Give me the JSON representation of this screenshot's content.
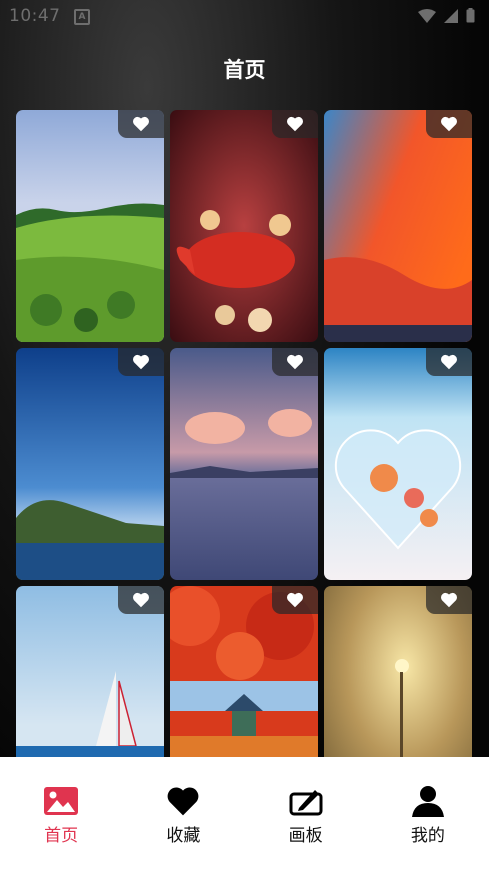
{
  "status_bar": {
    "time": "10:47",
    "notification_letter": "A"
  },
  "header": {
    "title": "首页"
  },
  "wallpapers": [
    {
      "row": 1,
      "col": 1,
      "subject": "green meadow with trees under blue sky",
      "favorite_icon": "heart-icon"
    },
    {
      "row": 1,
      "col": 2,
      "subject": "golden red koi fish with flowers",
      "favorite_icon": "heart-icon"
    },
    {
      "row": 1,
      "col": 3,
      "subject": "fiery orange sky with clouds over sea",
      "favorite_icon": "heart-icon"
    },
    {
      "row": 2,
      "col": 1,
      "subject": "blue sky over green mountain coast",
      "favorite_icon": "heart-icon"
    },
    {
      "row": 2,
      "col": 2,
      "subject": "pink clouds over calm lake",
      "favorite_icon": "heart-icon"
    },
    {
      "row": 2,
      "col": 3,
      "subject": "glass heart with roses on beach",
      "favorite_icon": "heart-icon"
    },
    {
      "row": 3,
      "col": 1,
      "subject": "white sailboat on blue sea",
      "favorite_icon": "heart-icon"
    },
    {
      "row": 3,
      "col": 2,
      "subject": "red maple leaves with pavilion",
      "favorite_icon": "heart-icon"
    },
    {
      "row": 3,
      "col": 3,
      "subject": "golden snowy trees with street lamp",
      "favorite_icon": "heart-icon"
    }
  ],
  "tabbar": {
    "items": [
      {
        "label": "首页",
        "icon": "image-icon",
        "active": true
      },
      {
        "label": "收藏",
        "icon": "heart-icon",
        "active": false
      },
      {
        "label": "画板",
        "icon": "drawing-board-icon",
        "active": false
      },
      {
        "label": "我的",
        "icon": "user-icon",
        "active": false
      }
    ]
  },
  "colors": {
    "accent": "#e0344f",
    "tabbar_bg": "#ffffff",
    "header_text": "#ffffff"
  }
}
